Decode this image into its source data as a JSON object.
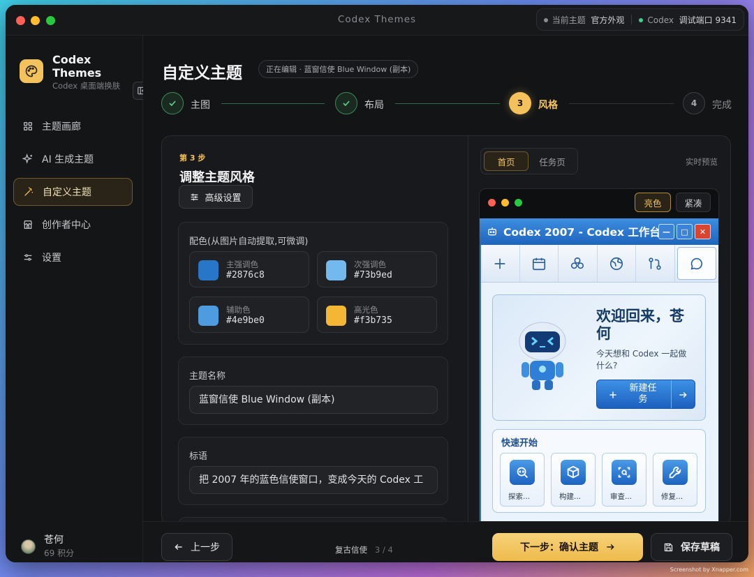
{
  "window": {
    "title": "Codex Themes"
  },
  "status": {
    "current_theme_label": "当前主题",
    "current_theme_value": "官方外观",
    "codex_label": "Codex",
    "debug_port": "调试端口 9341",
    "dot_gray": "#8a8b90",
    "dot_green": "#3fcf8e"
  },
  "brand": {
    "name": "Codex Themes",
    "subtitle": "Codex 桌面端换肤",
    "accent": "#f3c25c"
  },
  "sidebar": {
    "items": [
      {
        "label": "主题画廊",
        "icon": "grid-icon"
      },
      {
        "label": "AI 生成主题",
        "icon": "sparkle-icon"
      },
      {
        "label": "自定义主题",
        "icon": "magic-wand-icon"
      },
      {
        "label": "创作者中心",
        "icon": "store-icon"
      },
      {
        "label": "设置",
        "icon": "sliders-icon"
      }
    ]
  },
  "user": {
    "name": "苍何",
    "points": "69 积分"
  },
  "page": {
    "title": "自定义主题",
    "editing": "正在编辑 · 蓝窗信使 Blue Window (副本)"
  },
  "steps": [
    {
      "label": "主图",
      "num": "1"
    },
    {
      "label": "布局",
      "num": "2"
    },
    {
      "label": "风格",
      "num": "3"
    },
    {
      "label": "完成",
      "num": "4"
    }
  ],
  "editor": {
    "step_tag": "第 3 步",
    "heading": "调整主题风格",
    "advanced": "高级设置",
    "palette_label": "配色(从图片自动提取,可微调)",
    "swatches": [
      {
        "name": "主强调色",
        "hex": "#2876c8"
      },
      {
        "name": "次强调色",
        "hex": "#73b9ed"
      },
      {
        "name": "辅助色",
        "hex": "#4e9be0"
      },
      {
        "name": "高光色",
        "hex": "#f3b735"
      }
    ],
    "theme_name_label": "主题名称",
    "theme_name_value": "蓝窗信使 Blue Window (副本)",
    "slogan_label": "标语",
    "slogan_value": "把 2007 年的蓝色信使窗口，变成今天的 Codex 工"
  },
  "preview": {
    "tabs": [
      "首页",
      "任务页"
    ],
    "live_label": "实时预览",
    "modes": [
      "亮色",
      "紧凑"
    ],
    "app_title": "Codex 2007 - Codex 工作台",
    "welcome_line1": "欢迎回来，苍",
    "welcome_line2": "何",
    "welcome_sub1": "今天想和 Codex 一起做",
    "welcome_sub2": "什么?",
    "new_task_line1": "新建任",
    "new_task_line2": "务",
    "quick_title": "快速开始",
    "quick_items": [
      "探索...",
      "构建...",
      "审查...",
      "修复..."
    ]
  },
  "footer": {
    "prev": "上一步",
    "theme_name": "复古信使",
    "progress": "3 / 4",
    "next": "下一步：确认主题",
    "save": "保存草稿"
  },
  "watermark": "Screenshot by Xnapper.com"
}
